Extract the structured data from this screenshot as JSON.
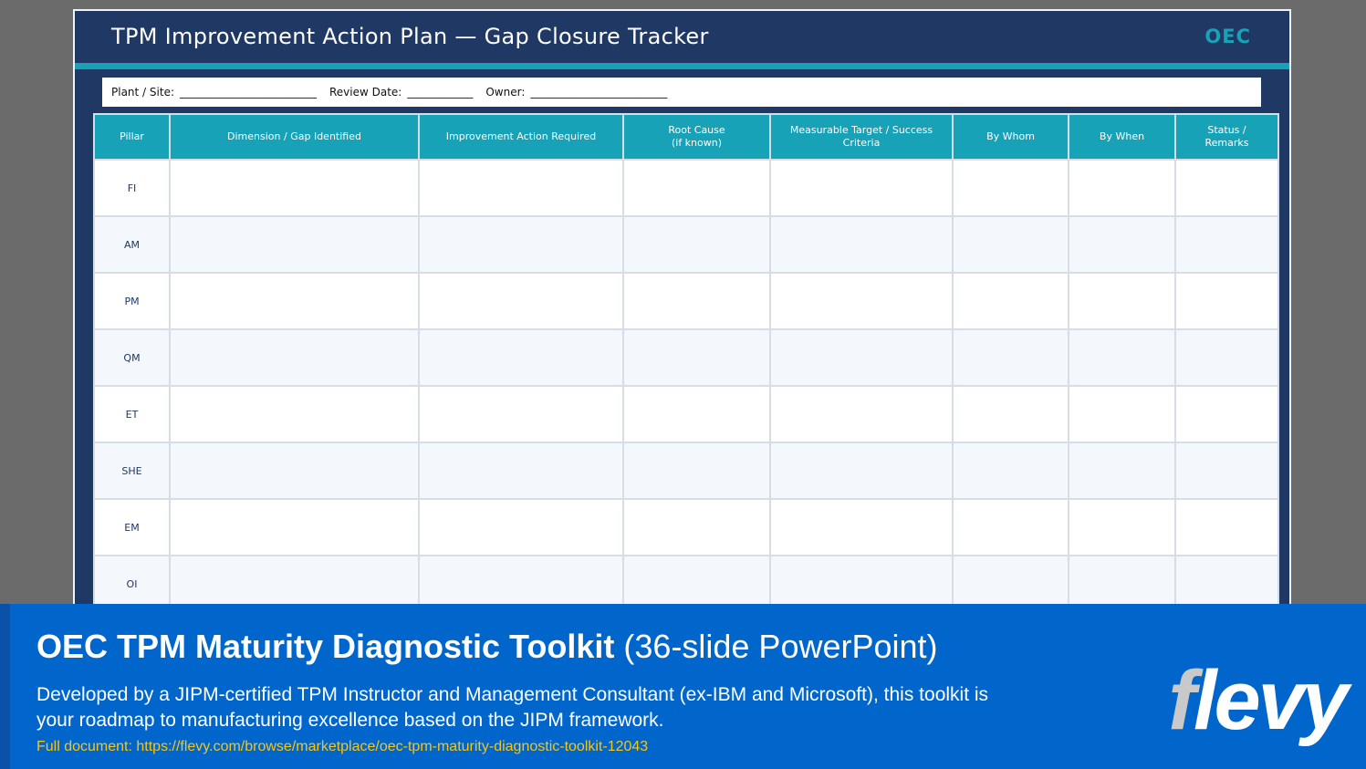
{
  "slide": {
    "title": "TPM Improvement Action Plan — Gap Closure Tracker",
    "brand": "OEC",
    "meta": {
      "plant_label": "Plant / Site:",
      "plant_blank": "_________________________",
      "review_label": "Review Date:",
      "review_blank": "____________",
      "owner_label": "Owner:",
      "owner_blank": "_________________________"
    },
    "table": {
      "headers": [
        "Pillar",
        "Dimension / Gap Identified",
        "Improvement Action Required",
        "Root Cause\n(if known)",
        "Measurable Target / Success Criteria",
        "By Whom",
        "By When",
        "Status /\nRemarks"
      ],
      "rows": [
        "FI",
        "AM",
        "PM",
        "QM",
        "ET",
        "SHE",
        "EM",
        "OI"
      ]
    }
  },
  "footer": {
    "title_bold": "OEC TPM Maturity Diagnostic Toolkit",
    "title_sub": "(36-slide PowerPoint)",
    "description": "Developed by a JIPM-certified TPM Instructor and Management Consultant (ex-IBM and Microsoft), this toolkit is your roadmap to manufacturing excellence based on the JIPM framework.",
    "link": "Full document: https://flevy.com/browse/marketplace/oec-tpm-maturity-diagnostic-toolkit-12043",
    "logo_first": "f",
    "logo_rest": "levy"
  },
  "colors": {
    "slide_bg": "#1f3864",
    "accent": "#17a2b8",
    "footer_bg": "#0066cc",
    "link": "#f5c518"
  }
}
